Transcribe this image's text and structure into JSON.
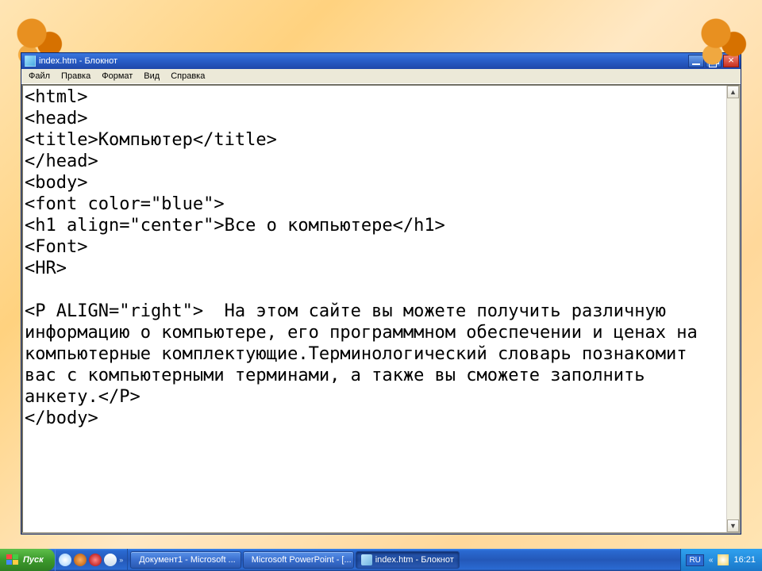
{
  "window": {
    "title": "index.htm - Блокнот",
    "menu": [
      "Файл",
      "Правка",
      "Формат",
      "Вид",
      "Справка"
    ]
  },
  "editor_text": "<html>\n<head>\n<title>Компьютер</title>\n</head>\n<body>\n<font color=\"blue\">\n<h1 align=\"center\">Все о компьютере</h1>\n<Font>\n<HR>\n\n<P ALIGN=\"right\">  На этом сайте вы можете получить различную информацию о компьютере, его программмном обеспечении и ценах на компьютерные комплектующие.Терминологический словарь познакомит вас с компьютерными терминами, а также вы сможете заполнить анкету.</P>\n</body>",
  "taskbar": {
    "start": "Пуск",
    "tasks": [
      {
        "label": "Документ1 - Microsoft ...",
        "icon": "word",
        "active": false
      },
      {
        "label": "Microsoft PowerPoint - [...",
        "icon": "pp",
        "active": false
      },
      {
        "label": "index.htm - Блокнот",
        "icon": "np",
        "active": true
      }
    ],
    "lang": "RU",
    "clock": "16:21"
  }
}
